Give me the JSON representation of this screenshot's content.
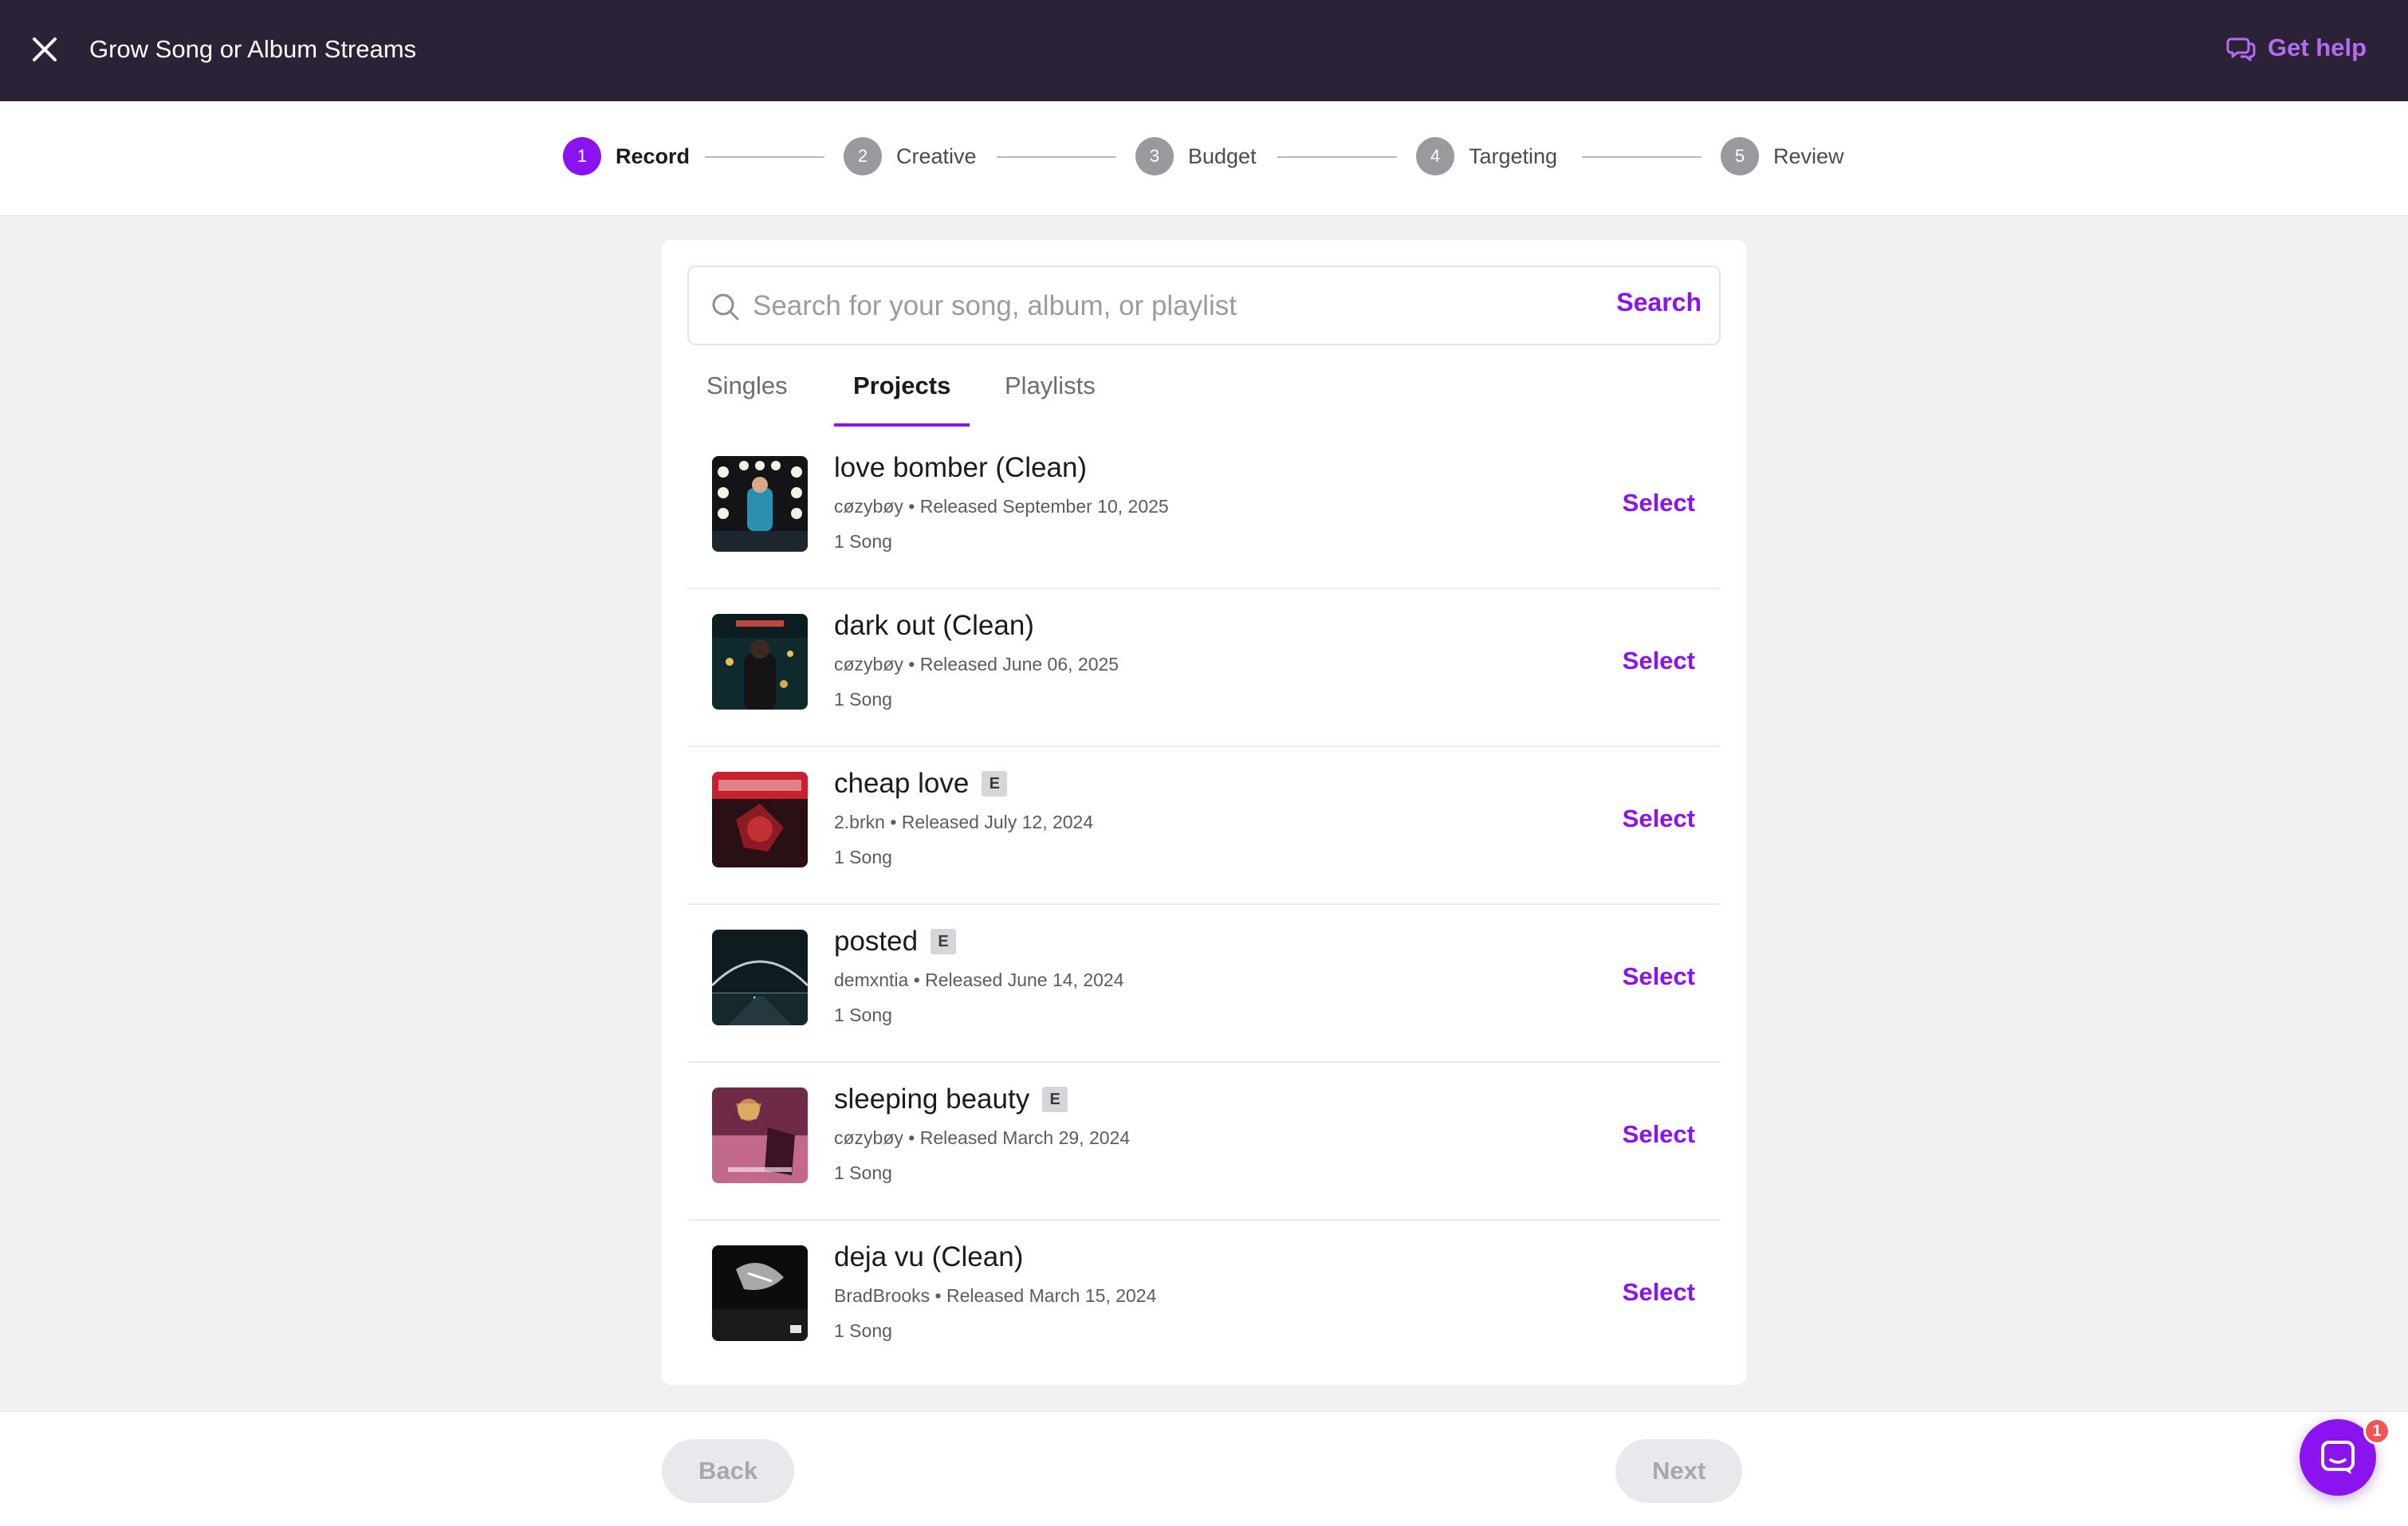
{
  "header": {
    "title": "Grow Song or Album Streams",
    "help_label": "Get help"
  },
  "stepper": {
    "steps": [
      {
        "number": "1",
        "label": "Record",
        "active": true
      },
      {
        "number": "2",
        "label": "Creative",
        "active": false
      },
      {
        "number": "3",
        "label": "Budget",
        "active": false
      },
      {
        "number": "4",
        "label": "Targeting",
        "active": false
      },
      {
        "number": "5",
        "label": "Review",
        "active": false
      }
    ]
  },
  "search": {
    "placeholder": "Search for your song, album, or playlist",
    "value": "",
    "button_label": "Search"
  },
  "tabs": [
    {
      "label": "Singles",
      "active": false
    },
    {
      "label": "Projects",
      "active": true
    },
    {
      "label": "Playlists",
      "active": false
    }
  ],
  "records": [
    {
      "title": "love bomber (Clean)",
      "explicit": false,
      "meta": "cøzybøy • Released September 10, 2025",
      "count": "1 Song",
      "select_label": "Select"
    },
    {
      "title": "dark out (Clean)",
      "explicit": false,
      "meta": "cøzybøy • Released June 06, 2025",
      "count": "1 Song",
      "select_label": "Select"
    },
    {
      "title": "cheap love",
      "explicit": true,
      "meta": "2.brkn • Released July 12, 2024",
      "count": "1 Song",
      "select_label": "Select"
    },
    {
      "title": "posted",
      "explicit": true,
      "meta": "demxntia • Released June 14, 2024",
      "count": "1 Song",
      "select_label": "Select"
    },
    {
      "title": "sleeping beauty",
      "explicit": true,
      "meta": "cøzybøy • Released March 29, 2024",
      "count": "1 Song",
      "select_label": "Select"
    },
    {
      "title": "deja vu (Clean)",
      "explicit": false,
      "meta": "BradBrooks • Released March 15, 2024",
      "count": "1 Song",
      "select_label": "Select"
    }
  ],
  "explicit_label": "E",
  "footer": {
    "back_label": "Back",
    "next_label": "Next"
  },
  "chat": {
    "icon": "chat-bubble-icon",
    "badge_count": "1"
  },
  "colors": {
    "accent": "#8b13f0",
    "header_bg": "#2b2237",
    "help_link": "#b36df0",
    "badge": "#f25555"
  }
}
